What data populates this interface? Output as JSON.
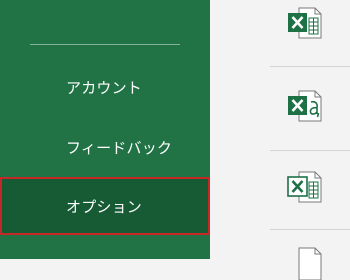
{
  "sidebar": {
    "items": [
      {
        "label": "アカウント"
      },
      {
        "label": "フィードバック"
      },
      {
        "label": "オプション",
        "selected": true
      }
    ]
  },
  "files": [
    {
      "icon": "excel-workbook-icon"
    },
    {
      "icon": "excel-addin-icon"
    },
    {
      "icon": "excel-xml-icon"
    }
  ],
  "colors": {
    "sidebar_bg": "#217346",
    "selected_bg": "#175b35",
    "selection_border": "#c62828",
    "excel_green": "#1e7145",
    "main_bg": "#f3f3f3"
  }
}
